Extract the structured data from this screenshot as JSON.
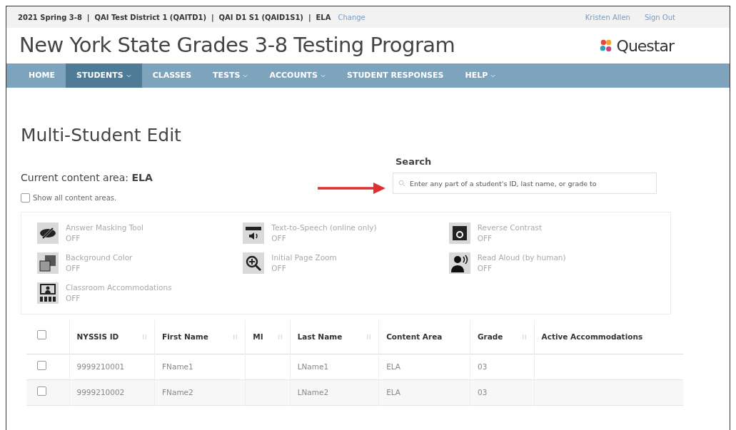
{
  "top_bar": {
    "context": "2021 Spring 3-8  |  QAI Test District 1 (QAITD1)  |  QAI D1 S1 (QAID1S1)  |  ELA",
    "change_link": "Change",
    "user": "Kristen Allen",
    "sign_out": "Sign Out"
  },
  "header": {
    "title": "New York State Grades 3-8 Testing Program",
    "logo_text": "Questar"
  },
  "nav": [
    {
      "label": "HOME",
      "selected": false,
      "dropdown": false
    },
    {
      "label": "STUDENTS",
      "selected": true,
      "dropdown": true
    },
    {
      "label": "CLASSES",
      "selected": false,
      "dropdown": false
    },
    {
      "label": "TESTS",
      "selected": false,
      "dropdown": true
    },
    {
      "label": "ACCOUNTS",
      "selected": false,
      "dropdown": true
    },
    {
      "label": "STUDENT RESPONSES",
      "selected": false,
      "dropdown": false
    },
    {
      "label": "HELP",
      "selected": false,
      "dropdown": true
    }
  ],
  "page": {
    "heading": "Multi-Student Edit",
    "content_area_label": "Current content area: **ELA**",
    "show_all": {
      "label": "Show all content areas.",
      "checked": false
    }
  },
  "search": {
    "label": "Search",
    "placeholder": "Enter any part of a student's ID, last name, or grade to"
  },
  "accommodations": [
    {
      "kind": "masking",
      "name": "Answer Masking Tool",
      "status": "OFF"
    },
    {
      "kind": "tts",
      "name": "Text-to-Speech (online only)",
      "status": "OFF"
    },
    {
      "kind": "contrast",
      "name": "Reverse Contrast",
      "status": "OFF"
    },
    {
      "kind": "background",
      "name": "Background Color",
      "status": "OFF"
    },
    {
      "kind": "zoom",
      "name": "Initial Page Zoom",
      "status": "OFF"
    },
    {
      "kind": "read_aloud",
      "name": "Read Aloud (by human)",
      "status": "OFF"
    },
    {
      "kind": "classroom",
      "name": "Classroom Accommodations",
      "status": "OFF"
    }
  ],
  "table": {
    "select_all": false,
    "columns": [
      {
        "label": "NYSSIS ID",
        "sortable": true
      },
      {
        "label": "First Name",
        "sortable": true
      },
      {
        "label": "MI",
        "sortable": true
      },
      {
        "label": "Last Name",
        "sortable": true
      },
      {
        "label": "Content Area",
        "sortable": false
      },
      {
        "label": "Grade",
        "sortable": true
      },
      {
        "label": "Active Accommodations",
        "sortable": false
      }
    ],
    "rows": [
      {
        "checked": false,
        "cells": [
          "9999210001",
          "FName1",
          "",
          "LName1",
          "ELA",
          "03",
          ""
        ]
      },
      {
        "checked": false,
        "cells": [
          "9999210002",
          "FName2",
          "",
          "LName2",
          "ELA",
          "03",
          ""
        ]
      }
    ]
  }
}
